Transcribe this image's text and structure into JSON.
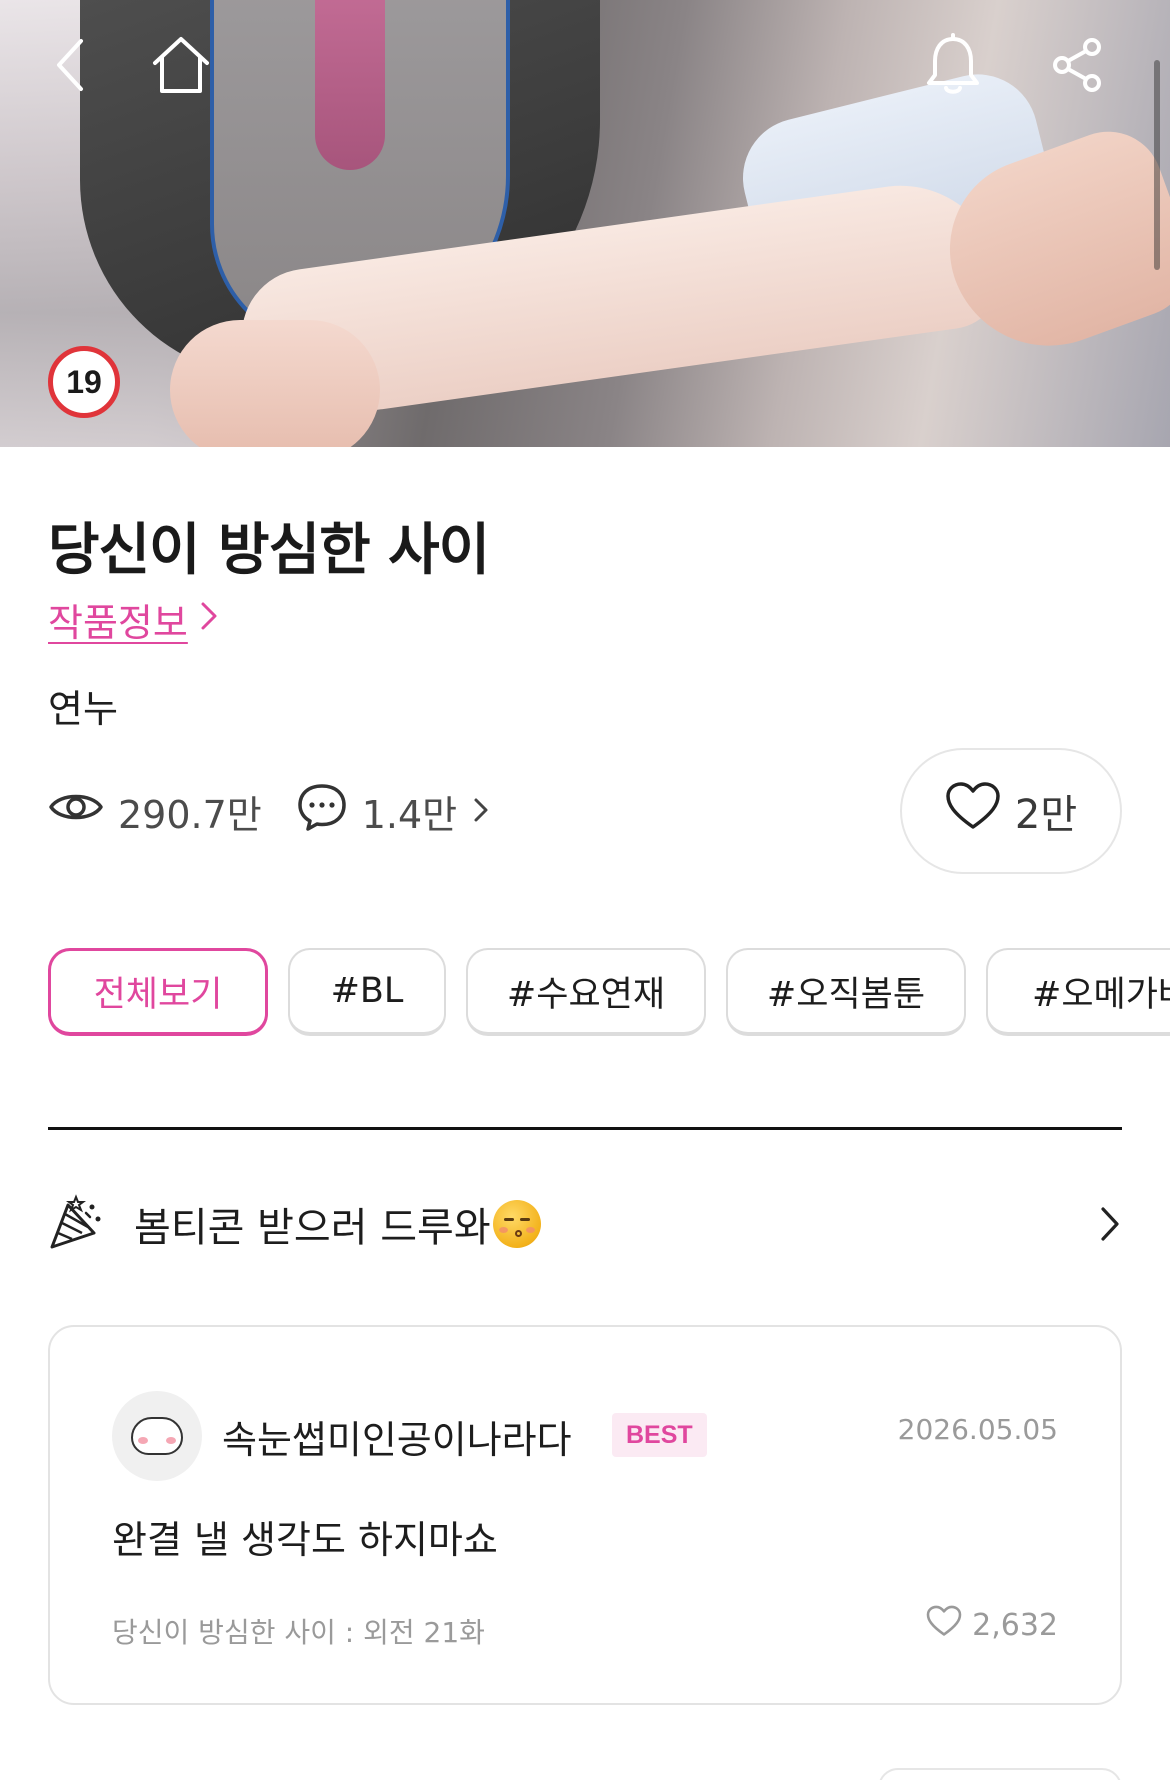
{
  "hero": {
    "age_rating": "19"
  },
  "work": {
    "title": "당신이 방심한 사이",
    "info_link": "작품정보",
    "author": "연누"
  },
  "stats": {
    "views": "290.7만",
    "comments": "1.4만",
    "likes": "2만"
  },
  "tags": [
    "전체보기",
    "#BL",
    "#수요연재",
    "#오직봄툰",
    "#오메가버"
  ],
  "event": {
    "label": "봄티콘 받으러 드루와"
  },
  "comment": {
    "nickname": "속눈썹미인공이나라다",
    "badge": "BEST",
    "date": "2026.05.05",
    "text": "완결 낼 생각도 하지마쇼",
    "episode": "당신이 방심한 사이 : 외전 21화",
    "likes": "2,632"
  },
  "icons": {
    "back": "chevron-left-icon",
    "home": "home-icon",
    "bell": "bell-icon",
    "share": "share-icon",
    "eye": "eye-icon",
    "comment": "comment-bubble-icon",
    "heart": "heart-icon",
    "party": "party-popper-icon"
  },
  "colors": {
    "accent": "#e0479e",
    "age_badge_ring": "#e0343a",
    "best_badge_bg": "#fbeaf3"
  }
}
